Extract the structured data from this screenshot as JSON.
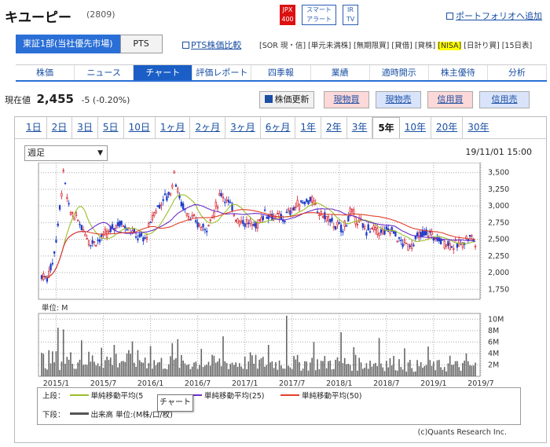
{
  "header": {
    "company": "キユーピー",
    "code": "(2809)",
    "badges": {
      "jpx": "JPX 400",
      "smart": "スマート アラート",
      "ir": "IR TV"
    },
    "portfolio_link": "ポートフォリオへ追加"
  },
  "market": {
    "primary": "東証1部(当社優先市場)",
    "pts": "PTS",
    "pts_compare": "PTS株価比較",
    "tags": [
      "[SOR 現・信]",
      "[単元未満株]",
      "[無期限買]",
      "[貸借]",
      "[貸株]",
      "[NISA]",
      "[日計り買]",
      "[15日表]"
    ]
  },
  "nav": {
    "tabs": [
      "株価",
      "ニュース",
      "チャート",
      "評価レポート",
      "四季報",
      "業績",
      "適時開示",
      "株主優待",
      "分析"
    ],
    "active": "チャート"
  },
  "quote": {
    "label": "現在値",
    "price": "2,455",
    "change": "-5 (-0.20%)",
    "refresh": "株価更新",
    "buy_spot": "現物買",
    "sell_spot": "現物売",
    "buy_margin": "信用買",
    "sell_margin": "信用売"
  },
  "periods": {
    "items": [
      "1日",
      "2日",
      "3日",
      "5日",
      "10日",
      "1ヶ月",
      "2ヶ月",
      "3ヶ月",
      "6ヶ月",
      "1年",
      "2年",
      "3年",
      "5年",
      "10年",
      "20年",
      "30年"
    ],
    "active": "5年"
  },
  "chart_controls": {
    "interval": "週足",
    "timestamp": "19/11/01 15:00"
  },
  "legend": {
    "upper_label": "上段：",
    "ma13": "単純移動平均(5",
    "ma25": "単純移動平均(25)",
    "ma50": "単純移動平均(50)",
    "lower_label": "下段：",
    "volume": "出来高 単位:(M株/口/枚)",
    "tooltip": "チャート",
    "credit": "(c)Quants Research Inc.",
    "colors": {
      "short": "#9bbd2c",
      "mid": "#6a2fc8",
      "long": "#e0402c",
      "up": "#d8202a",
      "down": "#1d3cc9",
      "volume": "#666666"
    }
  },
  "chart_data": {
    "type": "candlestick",
    "y_ticks": [
      "3,500",
      "3,250",
      "3,000",
      "2,750",
      "2,500",
      "2,250",
      "2,000",
      "1,750"
    ],
    "ylim": [
      1600,
      3650
    ],
    "x_ticks": [
      "2015/1",
      "2015/7",
      "2016/1",
      "2016/7",
      "2017/1",
      "2017/7",
      "2018/1",
      "2018/7",
      "2019/1",
      "2019/7"
    ],
    "volume_label": "単位: M",
    "volume_ticks": [
      "10M",
      "8M",
      "6M",
      "4M",
      "2M"
    ],
    "volume_ylim": [
      0,
      11
    ],
    "price_path": [
      [
        0,
        1950
      ],
      [
        3,
        1930
      ],
      [
        6,
        2150
      ],
      [
        9,
        2700
      ],
      [
        12,
        3500
      ],
      [
        15,
        2950
      ],
      [
        18,
        2850
      ],
      [
        22,
        2700
      ],
      [
        27,
        2450
      ],
      [
        32,
        2500
      ],
      [
        37,
        2600
      ],
      [
        42,
        2750
      ],
      [
        47,
        2700
      ],
      [
        52,
        2550
      ],
      [
        57,
        2500
      ],
      [
        62,
        2900
      ],
      [
        67,
        3100
      ],
      [
        71,
        3200
      ],
      [
        73,
        3500
      ],
      [
        76,
        3100
      ],
      [
        80,
        2900
      ],
      [
        85,
        2750
      ],
      [
        90,
        2650
      ],
      [
        95,
        2900
      ],
      [
        99,
        3200
      ],
      [
        103,
        3050
      ],
      [
        108,
        2800
      ],
      [
        113,
        2750
      ],
      [
        118,
        2700
      ],
      [
        123,
        2900
      ],
      [
        128,
        2850
      ],
      [
        133,
        2800
      ],
      [
        138,
        2950
      ],
      [
        143,
        3050
      ],
      [
        148,
        3100
      ],
      [
        153,
        2900
      ],
      [
        158,
        2800
      ],
      [
        162,
        2700
      ],
      [
        166,
        2650
      ],
      [
        170,
        2900
      ],
      [
        174,
        2800
      ],
      [
        178,
        2650
      ],
      [
        183,
        2650
      ],
      [
        188,
        2600
      ],
      [
        193,
        2650
      ],
      [
        198,
        2450
      ],
      [
        203,
        2400
      ],
      [
        208,
        2550
      ],
      [
        213,
        2600
      ],
      [
        218,
        2500
      ],
      [
        223,
        2450
      ],
      [
        228,
        2400
      ],
      [
        232,
        2450
      ],
      [
        236,
        2550
      ],
      [
        239,
        2455
      ]
    ],
    "volume_spikes": [
      [
        9,
        8.5
      ],
      [
        12,
        8.2
      ],
      [
        22,
        6.3
      ],
      [
        33,
        5.0
      ],
      [
        40,
        5.5
      ],
      [
        50,
        6.1
      ],
      [
        60,
        5.3
      ],
      [
        72,
        5.8
      ],
      [
        75,
        6.5
      ],
      [
        88,
        4.8
      ],
      [
        100,
        7.0
      ],
      [
        115,
        4.2
      ],
      [
        125,
        5.5
      ],
      [
        135,
        10.6
      ],
      [
        150,
        6.0
      ],
      [
        165,
        7.7
      ],
      [
        172,
        5.1
      ],
      [
        186,
        6.7
      ],
      [
        200,
        4.9
      ],
      [
        213,
        5.2
      ],
      [
        225,
        3.6
      ],
      [
        234,
        4.0
      ]
    ]
  }
}
